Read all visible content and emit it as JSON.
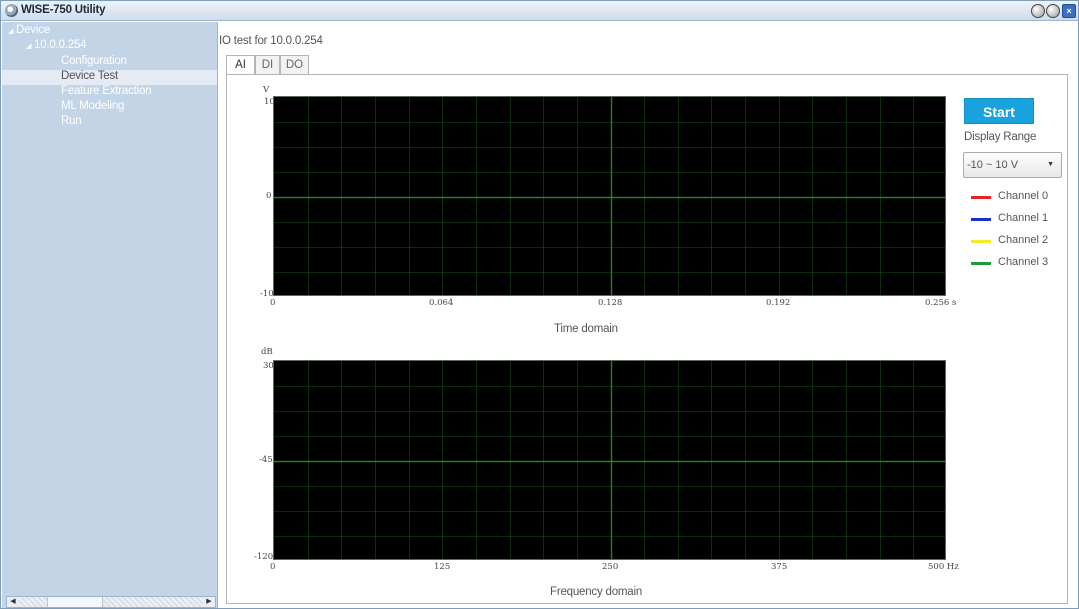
{
  "window": {
    "title": "WISE-750 Utility",
    "close_glyph": "×",
    "min_glyph": "⏻",
    "max_glyph": "⏻"
  },
  "sidebar": {
    "items": [
      {
        "label": "Device"
      },
      {
        "label": "10.0.0.254"
      },
      {
        "label": "Configuration"
      },
      {
        "label": "Device Test"
      },
      {
        "label": "Feature Extraction"
      },
      {
        "label": "ML Modeling"
      },
      {
        "label": "Run"
      }
    ]
  },
  "main": {
    "title": "IO test for 10.0.0.254",
    "tabs": [
      {
        "label": "AI"
      },
      {
        "label": "DI"
      },
      {
        "label": "DO"
      }
    ]
  },
  "time_plot": {
    "y_unit": "V",
    "y_ticks": [
      "10",
      "0",
      "-10"
    ],
    "x_ticks": [
      "0",
      "0.064",
      "0.128",
      "0.192",
      "0.256 s"
    ],
    "caption": "Time domain"
  },
  "freq_plot": {
    "y_unit": "dB",
    "y_ticks": [
      "30",
      "-45",
      "-120"
    ],
    "x_ticks": [
      "0",
      "125",
      "250",
      "375",
      "500 Hz"
    ],
    "caption": "Frequency domain"
  },
  "controls": {
    "start_label": "Start",
    "range_label": "Display Range",
    "range_value": "-10 ~ 10 V"
  },
  "legend": [
    {
      "label": "Channel 0",
      "color": "#e8202a"
    },
    {
      "label": "Channel 1",
      "color": "#1b2fd1"
    },
    {
      "label": "Channel 2",
      "color": "#f2ec2a"
    },
    {
      "label": "Channel 3",
      "color": "#1e9a3a"
    }
  ],
  "colors": {
    "accent": "#19a3de",
    "grid": "#2e8b2e",
    "plot_bg": "#000000"
  }
}
